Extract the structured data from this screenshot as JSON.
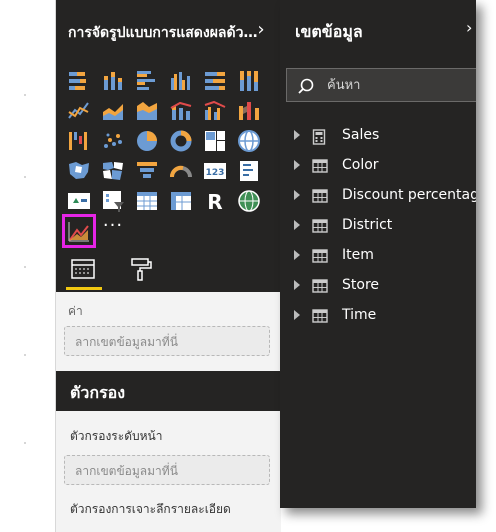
{
  "visualizations": {
    "title": "การจัดรูปแบบการแสดงผลด้วยภาพ",
    "collapse_icon": "chevron-right-icon",
    "icons": [
      "stacked-bar-chart-icon",
      "stacked-column-chart-icon",
      "clustered-bar-chart-icon",
      "clustered-column-chart-icon",
      "100-stacked-bar-chart-icon",
      "100-stacked-column-chart-icon",
      "line-chart-icon",
      "area-chart-icon",
      "stacked-area-chart-icon",
      "line-and-stacked-column-chart-icon",
      "line-and-clustered-column-chart-icon",
      "ribbon-chart-icon",
      "waterfall-chart-icon",
      "scatter-chart-icon",
      "pie-chart-icon",
      "donut-chart-icon",
      "treemap-icon",
      "map-icon",
      "filled-map-icon",
      "shape-map-icon",
      "funnel-icon",
      "gauge-icon",
      "card-icon",
      "multi-row-card-icon",
      "kpi-icon",
      "slicer-icon",
      "table-icon",
      "matrix-icon",
      "r-script-visual-icon",
      "arcgis-map-icon",
      "custom-visual-icon"
    ],
    "selected_icon": "custom-visual-icon",
    "more_label": "···",
    "tabs": [
      "fields-tab",
      "format-tab"
    ],
    "value_well": {
      "label": "ค่า",
      "placeholder": "ลากเขตข้อมูลมาที่นี่"
    },
    "filters": {
      "title": "ตัวกรอง",
      "page_level_label": "ตัวกรองระดับหน้า",
      "page_level_placeholder": "ลากเขตข้อมูลมาที่นี่",
      "drillthrough_label": "ตัวกรองการเจาะลึกรายละเอียด"
    }
  },
  "fields": {
    "title": "เขตข้อมูล",
    "search": {
      "placeholder": "ค้นหา"
    },
    "items": [
      {
        "label": "Sales",
        "icon": "calculator-icon"
      },
      {
        "label": "Color",
        "icon": "table-icon"
      },
      {
        "label": "Discount percentage",
        "icon": "table-icon"
      },
      {
        "label": "District",
        "icon": "table-icon"
      },
      {
        "label": "Item",
        "icon": "table-icon"
      },
      {
        "label": "Store",
        "icon": "table-icon"
      },
      {
        "label": "Time",
        "icon": "table-icon"
      }
    ]
  },
  "colors": {
    "pane_dark": "#252423",
    "accent_yellow": "#f2c811",
    "selection_magenta": "#e625e6",
    "icon_orange": "#f2a540",
    "icon_blue": "#6c9bd3"
  }
}
